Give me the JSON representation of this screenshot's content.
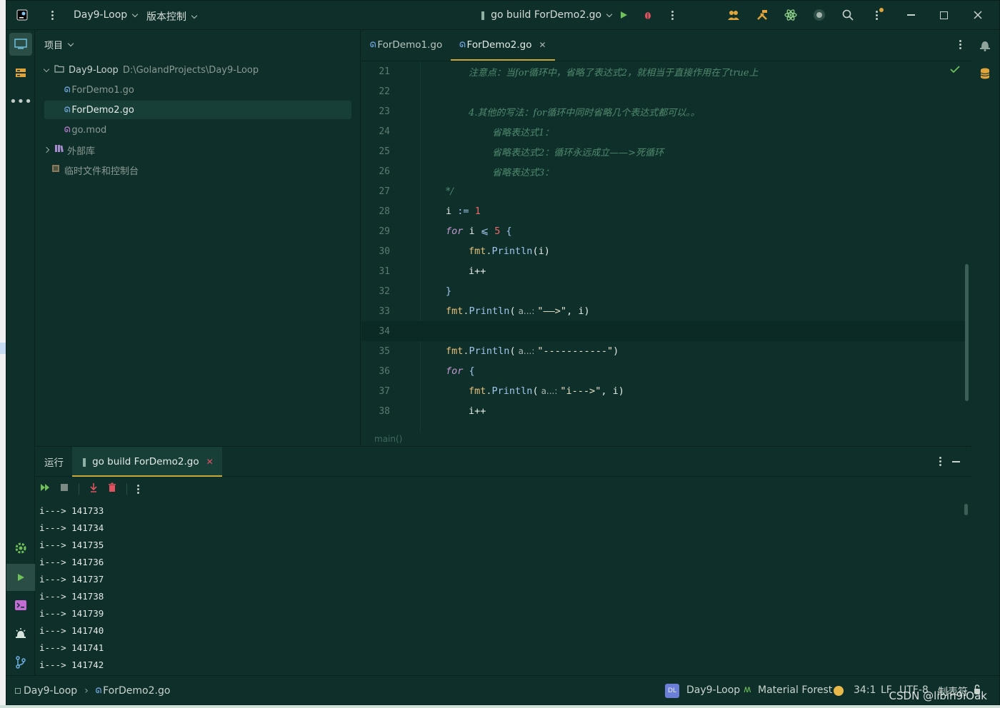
{
  "titlebar": {
    "project": "Day9-Loop",
    "vcs": "版本控制",
    "run_config": "go build ForDemo2.go"
  },
  "project_panel": {
    "title": "项目",
    "root_name": "Day9-Loop",
    "root_path": "D:\\GolandProjects\\Day9-Loop",
    "files": [
      "ForDemo1.go",
      "ForDemo2.go",
      "go.mod"
    ],
    "external_libs": "外部库",
    "scratches": "临时文件和控制台"
  },
  "editor": {
    "tabs": [
      "ForDemo1.go",
      "ForDemo2.go"
    ],
    "breadcrumb": "main()",
    "line_numbers": [
      "21",
      "22",
      "23",
      "24",
      "25",
      "26",
      "27",
      "28",
      "29",
      "30",
      "31",
      "32",
      "33",
      "34",
      "35",
      "36",
      "37",
      "38"
    ],
    "comments": {
      "l21": "注意点：当for循环中，省略了表达式2，就相当于直接作用在了true上",
      "l23": "4.其他的写法：for循环中同时省略几个表达式都可以。。",
      "l24": "省略表达式1：",
      "l25": "省略表达式2：循环永远成立——>死循环",
      "l26": "省略表达式3：",
      "l27": "*/"
    },
    "tokens": {
      "i": "i",
      "assign": ":=",
      "one": "1",
      "for": "for",
      "le": "⩽",
      "five": "5",
      "lbrace": "{",
      "rbrace": "}",
      "fmt": "fmt",
      "dot": ".",
      "println": "Println",
      "paren_open": "(",
      "paren_i_close": "(i)",
      "inc": "i++",
      "hint": "a...:",
      "arrow_str": "\"——>\"",
      "dash_str": "\"-----------\"",
      "iarrow_str": "\"i--->\"",
      "comma_i": ", i)",
      "close_paren": ")"
    }
  },
  "run_panel": {
    "label": "运行",
    "tab": "go build ForDemo2.go",
    "output": [
      "i---> 141733",
      "i---> 141734",
      "i---> 141735",
      "i---> 141736",
      "i---> 141737",
      "i---> 141738",
      "i---> 141739",
      "i---> 141740",
      "i---> 141741",
      "i---> 141742"
    ]
  },
  "statusbar": {
    "project": "Day9-Loop",
    "file": "ForDemo2.go",
    "avatar": "DL",
    "branch": "Day9-Loop",
    "theme": "Material Forest",
    "position": "34:1",
    "line_sep": "LF",
    "encoding": "UTF-8",
    "indent": "制表符"
  },
  "watermark": "CSDN @libin9iOak",
  "colors": {
    "accent": "#c9a83a",
    "bg": "#0f2f2a",
    "run_green": "#6fbf5a",
    "debug_red": "#e05260"
  }
}
